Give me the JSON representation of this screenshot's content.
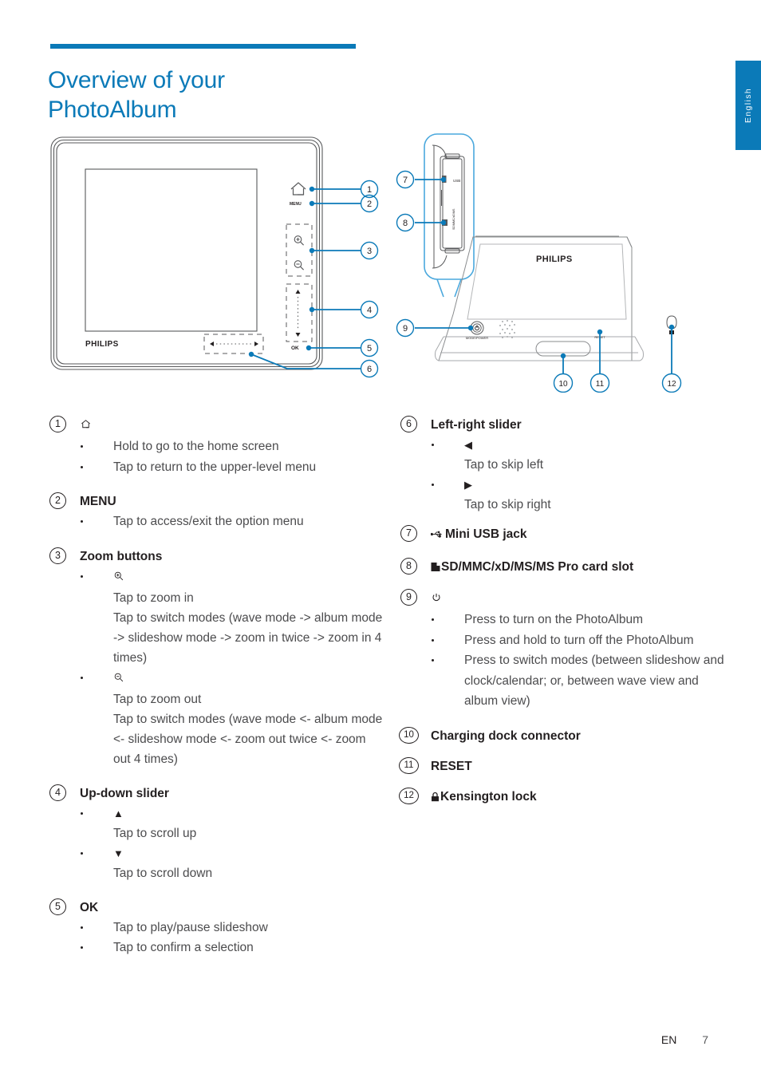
{
  "page": {
    "title": "Overview of your\nPhotoAlbum",
    "language_tab": "English",
    "accent_color": "#0b7ab8",
    "footer": {
      "language_code": "EN",
      "page_number": "7"
    }
  },
  "figures": {
    "front": {
      "brand": "PHILIPS",
      "callouts": [
        "1",
        "2",
        "3",
        "4",
        "5",
        "6"
      ],
      "button_labels": {
        "menu": "MENU",
        "ok": "OK"
      }
    },
    "back": {
      "brand": "PHILIPS",
      "callouts": [
        "7",
        "8",
        "9",
        "10",
        "11",
        "12"
      ],
      "labels": {
        "power": "MODE/POWER",
        "reset": "RESET",
        "card_slot": "SD/MMC/xD/MS",
        "usb": "USB"
      }
    }
  },
  "left_column": [
    {
      "number": "1",
      "icon": "home-icon",
      "heading": "",
      "bullets": [
        {
          "text": "Hold to go to the home screen"
        },
        {
          "text": "Tap to return to the upper-level menu"
        }
      ]
    },
    {
      "number": "2",
      "heading": "MENU",
      "bullets": [
        {
          "text": "Tap to access/exit the option menu"
        }
      ]
    },
    {
      "number": "3",
      "heading": "Zoom buttons",
      "bullets": [
        {
          "symbol": "zoom-in-icon",
          "lines": [
            "Tap to zoom in",
            "Tap to switch modes (wave mode -> album mode -> slideshow mode -> zoom in twice -> zoom in 4 times)"
          ]
        },
        {
          "symbol": "zoom-out-icon",
          "lines": [
            "Tap to zoom out",
            "Tap to switch modes (wave mode <- album mode <- slideshow mode <- zoom out twice <- zoom out 4 times)"
          ]
        }
      ]
    },
    {
      "number": "4",
      "heading": "Up-down slider",
      "bullets": [
        {
          "symbol": "▲",
          "lines": [
            "Tap to scroll up"
          ]
        },
        {
          "symbol": "▼",
          "lines": [
            "Tap to scroll down"
          ]
        }
      ]
    },
    {
      "number": "5",
      "heading": "OK",
      "bullets": [
        {
          "text": "Tap to play/pause slideshow"
        },
        {
          "text": "Tap to confirm a selection"
        }
      ]
    }
  ],
  "right_column": [
    {
      "number": "6",
      "heading": "Left-right slider",
      "bullets": [
        {
          "symbol": "◀",
          "lines": [
            "Tap to skip left"
          ]
        },
        {
          "symbol": "▶",
          "lines": [
            "Tap to skip right"
          ]
        }
      ]
    },
    {
      "number": "7",
      "icon": "usb-icon",
      "heading": "Mini USB jack",
      "bullets": []
    },
    {
      "number": "8",
      "icon": "card-slot-icon",
      "heading": "SD/MMC/xD/MS/MS Pro card slot",
      "bullets": []
    },
    {
      "number": "9",
      "icon": "power-icon",
      "heading": "",
      "bullets": [
        {
          "text": "Press to turn on the PhotoAlbum"
        },
        {
          "text": "Press and hold to turn off the PhotoAlbum"
        },
        {
          "text": "Press to switch modes (between slideshow and clock/calendar; or, between wave view and album view)"
        }
      ]
    },
    {
      "number": "10",
      "heading": "Charging dock connector",
      "bullets": []
    },
    {
      "number": "11",
      "heading": "RESET",
      "bullets": []
    },
    {
      "number": "12",
      "icon": "lock-icon",
      "heading": "Kensington lock",
      "bullets": []
    }
  ]
}
